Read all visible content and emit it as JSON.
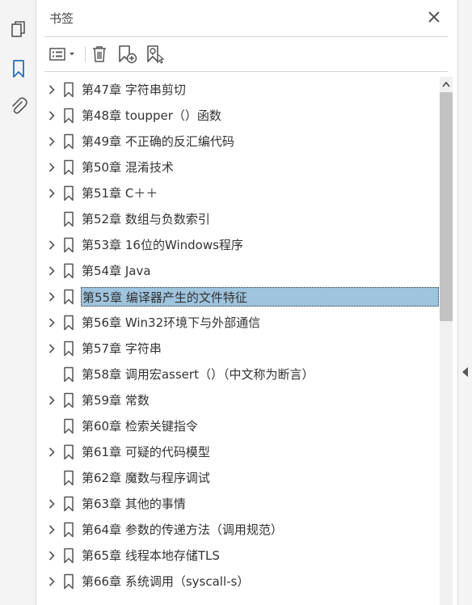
{
  "left_rail": {
    "items": [
      {
        "name": "pages-icon"
      },
      {
        "name": "bookmark-panel-icon"
      },
      {
        "name": "attachment-icon"
      }
    ]
  },
  "panel": {
    "title": "书签",
    "close_icon": "close-icon"
  },
  "toolbar": {
    "buttons": [
      "options-menu-icon",
      "delete-icon",
      "new-bookmark-icon",
      "expand-bookmark-icon"
    ]
  },
  "bookmarks": [
    {
      "label": "第47章  字符串剪切",
      "expandable": true
    },
    {
      "label": "第48章  toupper（）函数",
      "expandable": true
    },
    {
      "label": "第49章  不正确的反汇编代码",
      "expandable": true
    },
    {
      "label": "第50章  混淆技术",
      "expandable": true
    },
    {
      "label": "第51章  C＋＋",
      "expandable": true
    },
    {
      "label": "第52章  数组与负数索引",
      "expandable": false
    },
    {
      "label": "第53章  16位的Windows程序",
      "expandable": true
    },
    {
      "label": "第54章  Java",
      "expandable": true
    },
    {
      "label": "第55章  编译器产生的文件特征",
      "expandable": true,
      "selected": true
    },
    {
      "label": "第56章  Win32环境下与外部通信",
      "expandable": true
    },
    {
      "label": "第57章  字符串",
      "expandable": true
    },
    {
      "label": "第58章  调用宏assert（）（中文称为断言）",
      "expandable": false
    },
    {
      "label": "第59章  常数",
      "expandable": true
    },
    {
      "label": "第60章  检索关键指令",
      "expandable": false
    },
    {
      "label": "第61章  可疑的代码模型",
      "expandable": true
    },
    {
      "label": "第62章  魔数与程序调试",
      "expandable": false
    },
    {
      "label": "第63章  其他的事情",
      "expandable": true
    },
    {
      "label": "第64章  参数的传递方法（调用规范）",
      "expandable": true
    },
    {
      "label": "第65章  线程本地存储TLS",
      "expandable": true
    },
    {
      "label": "第66章  系统调用（syscall-s）",
      "expandable": true
    }
  ],
  "colors": {
    "selection": "#9ec4de",
    "accent": "#2a6ebb",
    "icon": "#555555"
  }
}
